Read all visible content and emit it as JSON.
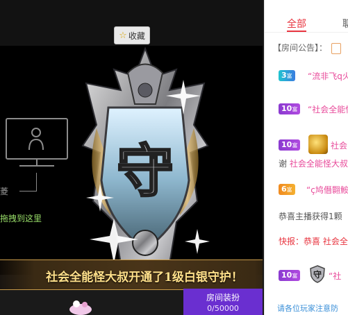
{
  "stage": {
    "favorite_label": "收藏",
    "cut_text": "菱",
    "drag_hint": "拖拽到这里",
    "banner_text": "社会全能怪大叔开通了1级白银守护！",
    "emblem_char": "守",
    "guard": {
      "title": "房间装扮",
      "progress_text": "0/50000",
      "progress": 0
    }
  },
  "panel": {
    "tabs": [
      {
        "label": "全部",
        "active": true
      },
      {
        "label": "聊"
      }
    ],
    "notice_label": "【房间公告】：",
    "messages": [
      {
        "badge": "3",
        "badge_sub": "富",
        "text": "“流非飞q火"
      },
      {
        "badge": "10",
        "badge_sub": "富",
        "text": "“社会全能怪"
      },
      {
        "badge": "10",
        "badge_sub": "富",
        "text": "社会"
      },
      {
        "prefix": "谢",
        "name": "社会全能怪大叔"
      },
      {
        "badge": "6",
        "badge_sub": "富",
        "text": "“ç鸠僭翾鮟"
      },
      {
        "plain": "恭喜主播获得1颗"
      },
      {
        "flash_label": "快报：",
        "flash_text": "恭喜",
        "name": "社会全"
      },
      {
        "badge": "10",
        "badge_sub": "富",
        "text": "“社"
      }
    ],
    "footer": "请各位玩家注意防"
  },
  "colors": {
    "accent": "#e8343f",
    "name_pink": "#e84a9a",
    "guard_purple": "#6a2fd0",
    "banner_gold": "#ffe08a"
  }
}
